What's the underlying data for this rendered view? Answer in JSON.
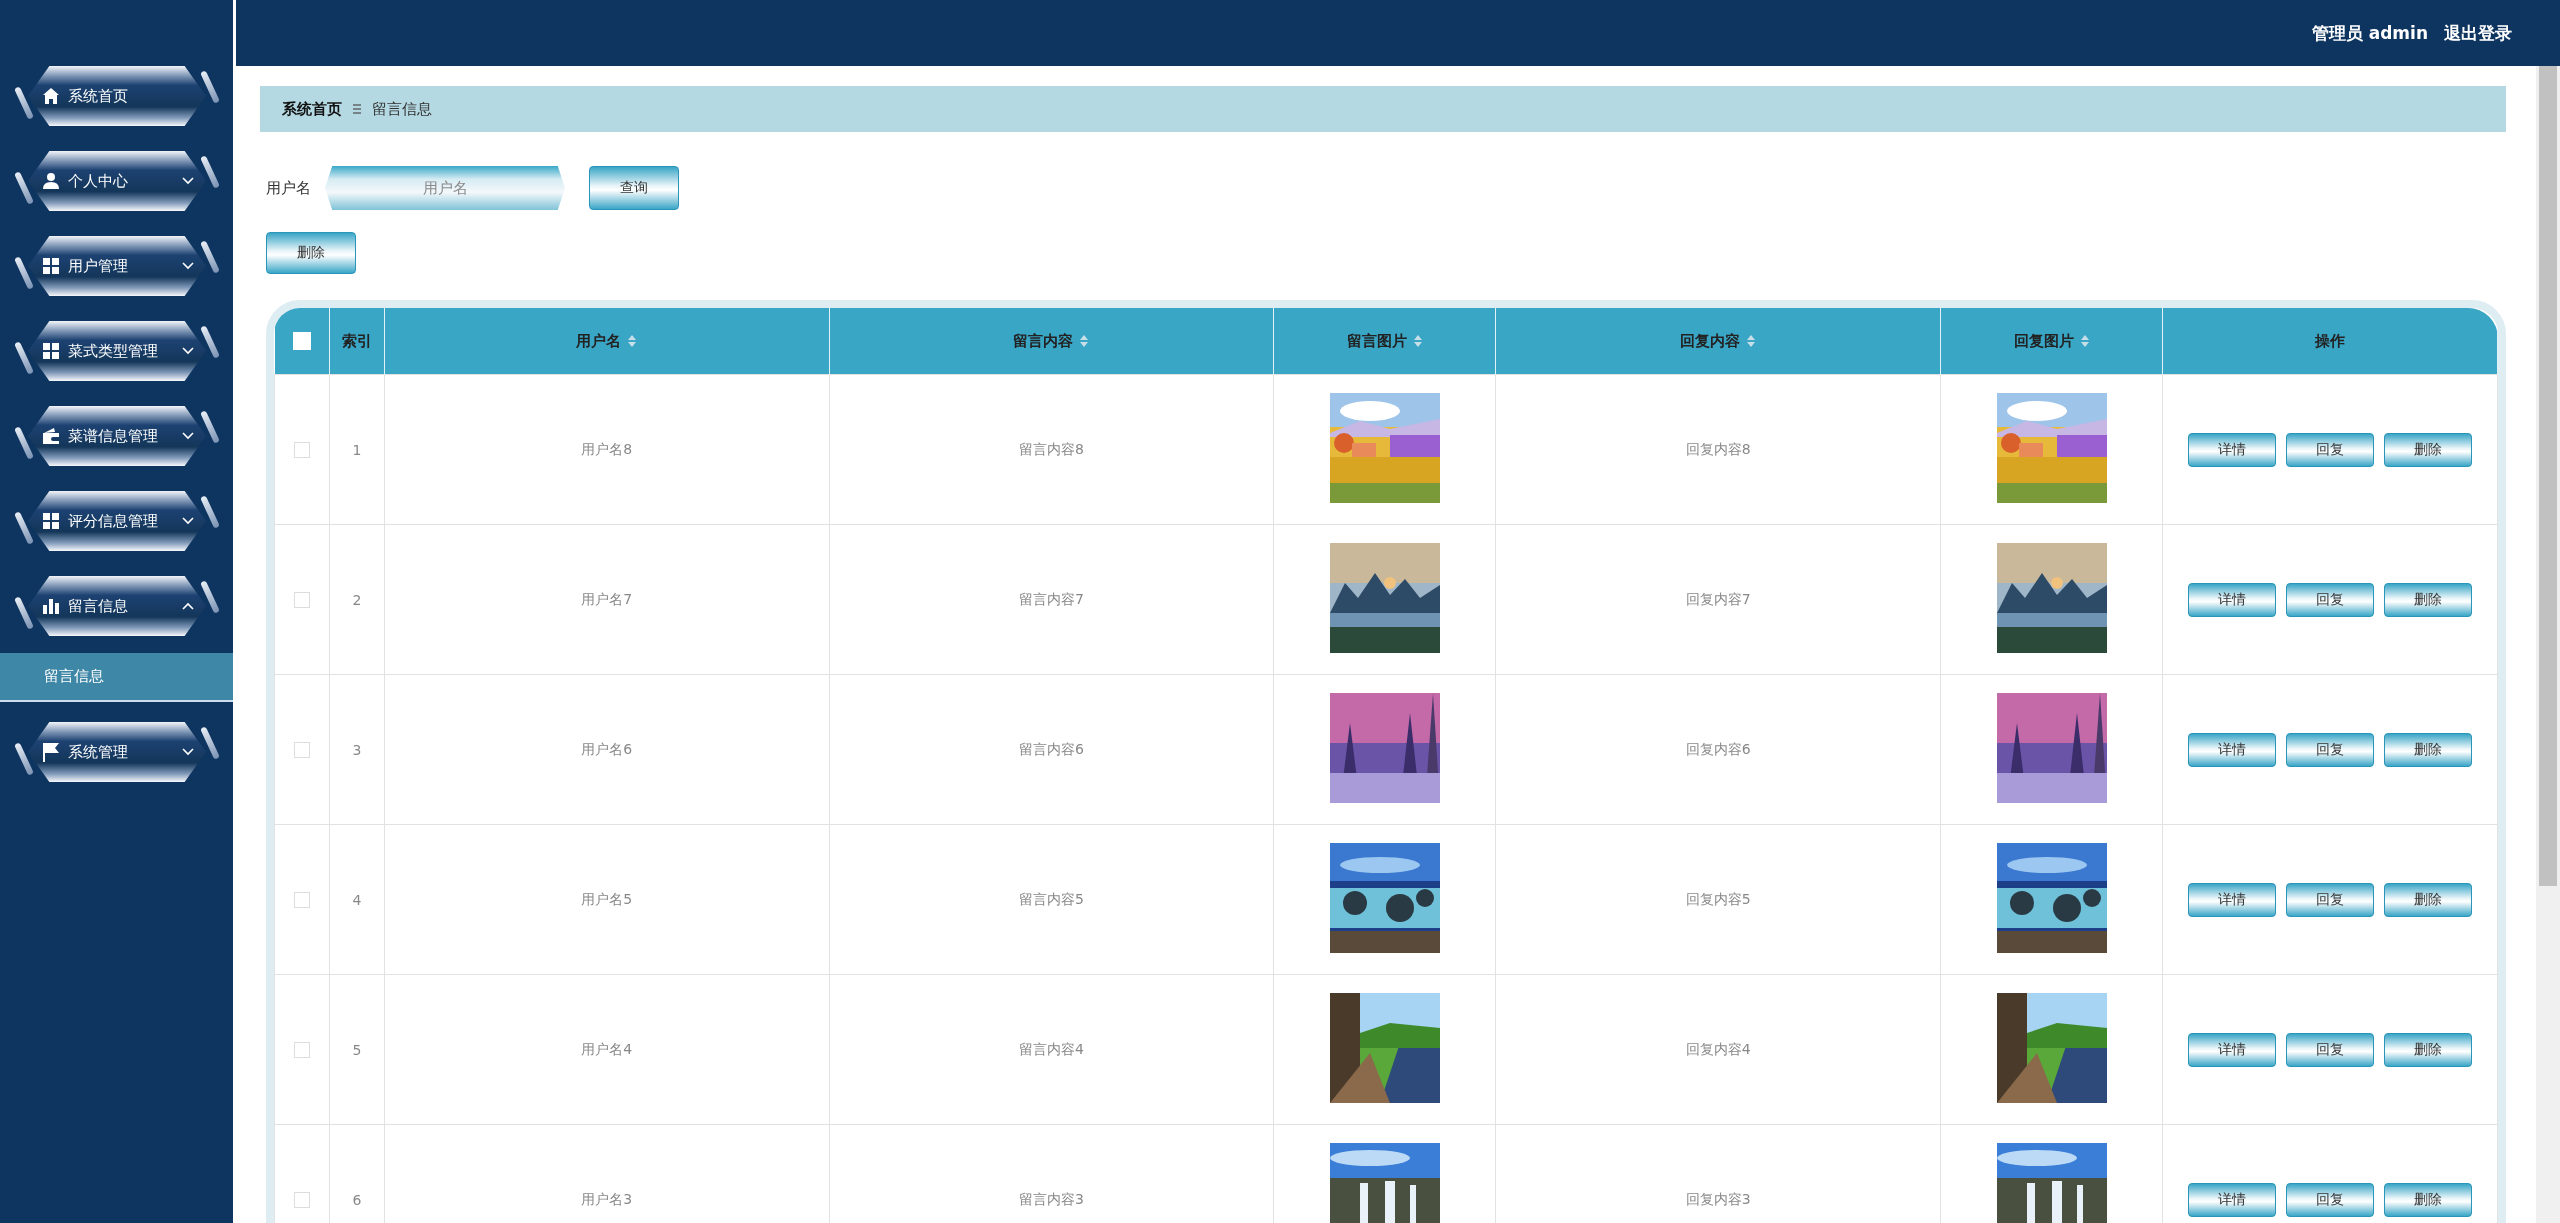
{
  "header": {
    "user_label": "管理员 admin",
    "logout": "退出登录"
  },
  "sidebar": {
    "items": [
      {
        "label": "系统首页"
      },
      {
        "label": "个人中心",
        "expanded": false
      },
      {
        "label": "用户管理",
        "expanded": false
      },
      {
        "label": "菜式类型管理",
        "expanded": false
      },
      {
        "label": "菜谱信息管理",
        "expanded": false
      },
      {
        "label": "评分信息管理",
        "expanded": false
      },
      {
        "label": "留言信息",
        "expanded": true,
        "children": [
          {
            "label": "留言信息",
            "selected": true
          }
        ]
      },
      {
        "label": "系统管理",
        "expanded": false
      }
    ]
  },
  "breadcrumb": [
    "系统首页",
    "留言信息"
  ],
  "search": {
    "label": "用户名",
    "placeholder": "用户名",
    "button": "查询"
  },
  "delete_button": "删除",
  "table": {
    "header_checked": false,
    "columns": [
      {
        "label": "索引",
        "kind": "plain"
      },
      {
        "label": "用户名",
        "kind": "sortable"
      },
      {
        "label": "留言内容",
        "kind": "sortable"
      },
      {
        "label": "留言图片",
        "kind": "sortable"
      },
      {
        "label": "回复内容",
        "kind": "sortable"
      },
      {
        "label": "回复图片",
        "kind": "sortable"
      },
      {
        "label": "操作",
        "kind": "plain"
      }
    ],
    "rows": [
      {
        "checked": false,
        "index": "1",
        "username": "用户名8",
        "content": "留言内容8",
        "reply": "回复内容8",
        "actions": [
          "详情",
          "回复",
          "删除"
        ]
      },
      {
        "checked": false,
        "index": "2",
        "username": "用户名7",
        "content": "留言内容7",
        "reply": "回复内容7",
        "actions": [
          "详情",
          "回复",
          "删除"
        ]
      },
      {
        "checked": false,
        "index": "3",
        "username": "用户名6",
        "content": "留言内容6",
        "reply": "回复内容6",
        "actions": [
          "详情",
          "回复",
          "删除"
        ]
      },
      {
        "checked": false,
        "index": "4",
        "username": "用户名5",
        "content": "留言内容5",
        "reply": "回复内容5",
        "actions": [
          "详情",
          "回复",
          "删除"
        ]
      },
      {
        "checked": false,
        "index": "5",
        "username": "用户名4",
        "content": "留言内容4",
        "reply": "回复内容4",
        "actions": [
          "详情",
          "回复",
          "删除"
        ]
      },
      {
        "checked": false,
        "index": "6",
        "username": "用户名3",
        "content": "留言内容3",
        "reply": "回复内容3",
        "actions": [
          "详情",
          "回复",
          "删除"
        ]
      }
    ]
  }
}
